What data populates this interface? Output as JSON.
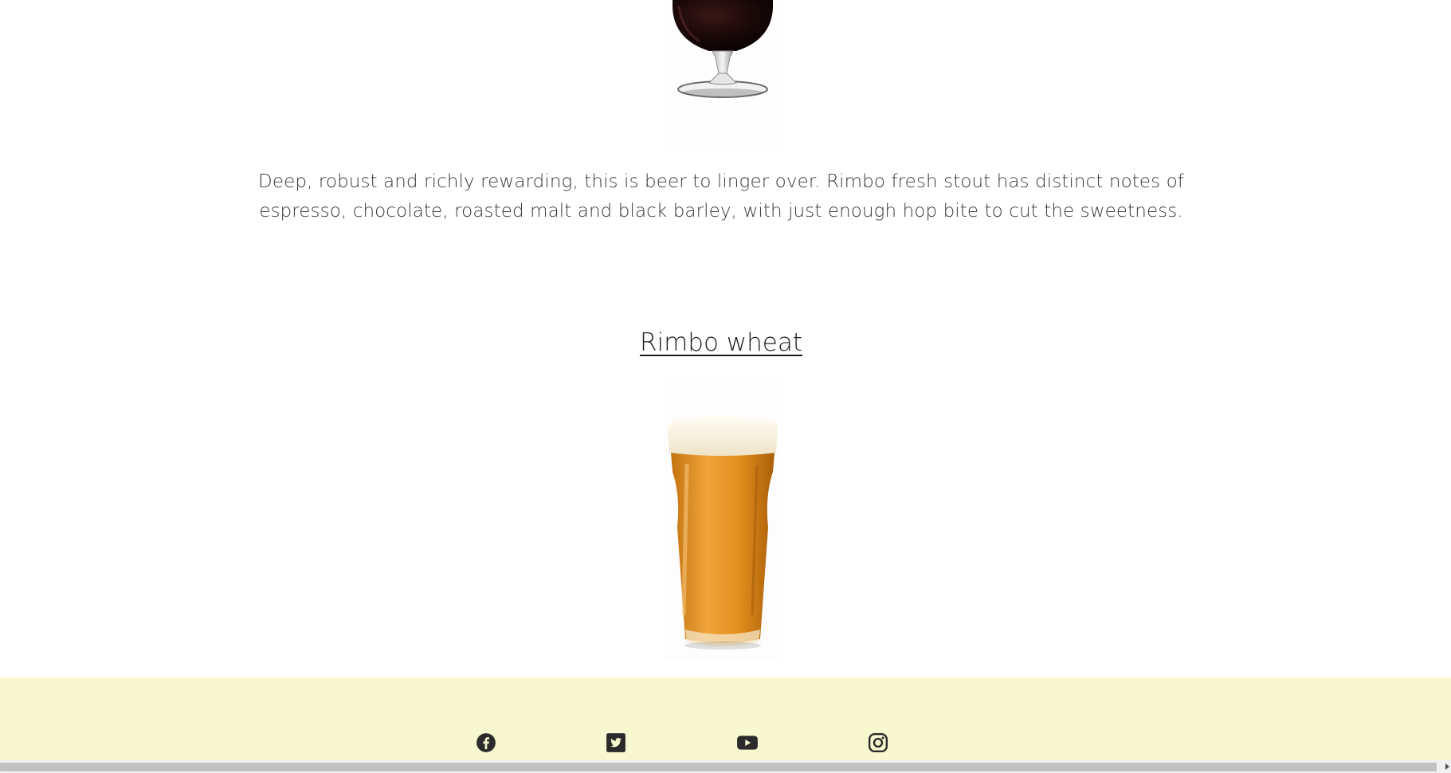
{
  "stout": {
    "image_alt": "Rimbo fresh stout glass",
    "description": "Deep, robust and richly rewarding, this is beer to linger over. Rimbo fresh stout has distinct notes of espresso, chocolate, roasted malt and black barley, with just enough hop bite to cut the sweetness."
  },
  "wheat": {
    "title": "Rimbo wheat",
    "image_alt": "Rimbo wheat pint glass"
  },
  "footer": {
    "background": "#f8f8d0",
    "social": [
      {
        "name": "facebook",
        "icon": "facebook-icon"
      },
      {
        "name": "twitter",
        "icon": "twitter-icon"
      },
      {
        "name": "youtube",
        "icon": "youtube-icon"
      },
      {
        "name": "instagram",
        "icon": "instagram-icon"
      }
    ]
  },
  "colors": {
    "text": "#3a3a3a",
    "heading": "#1f1f1f",
    "icon": "#2b2b2b",
    "stout": "#1a0c0c",
    "wheat": "#d98a1c"
  }
}
